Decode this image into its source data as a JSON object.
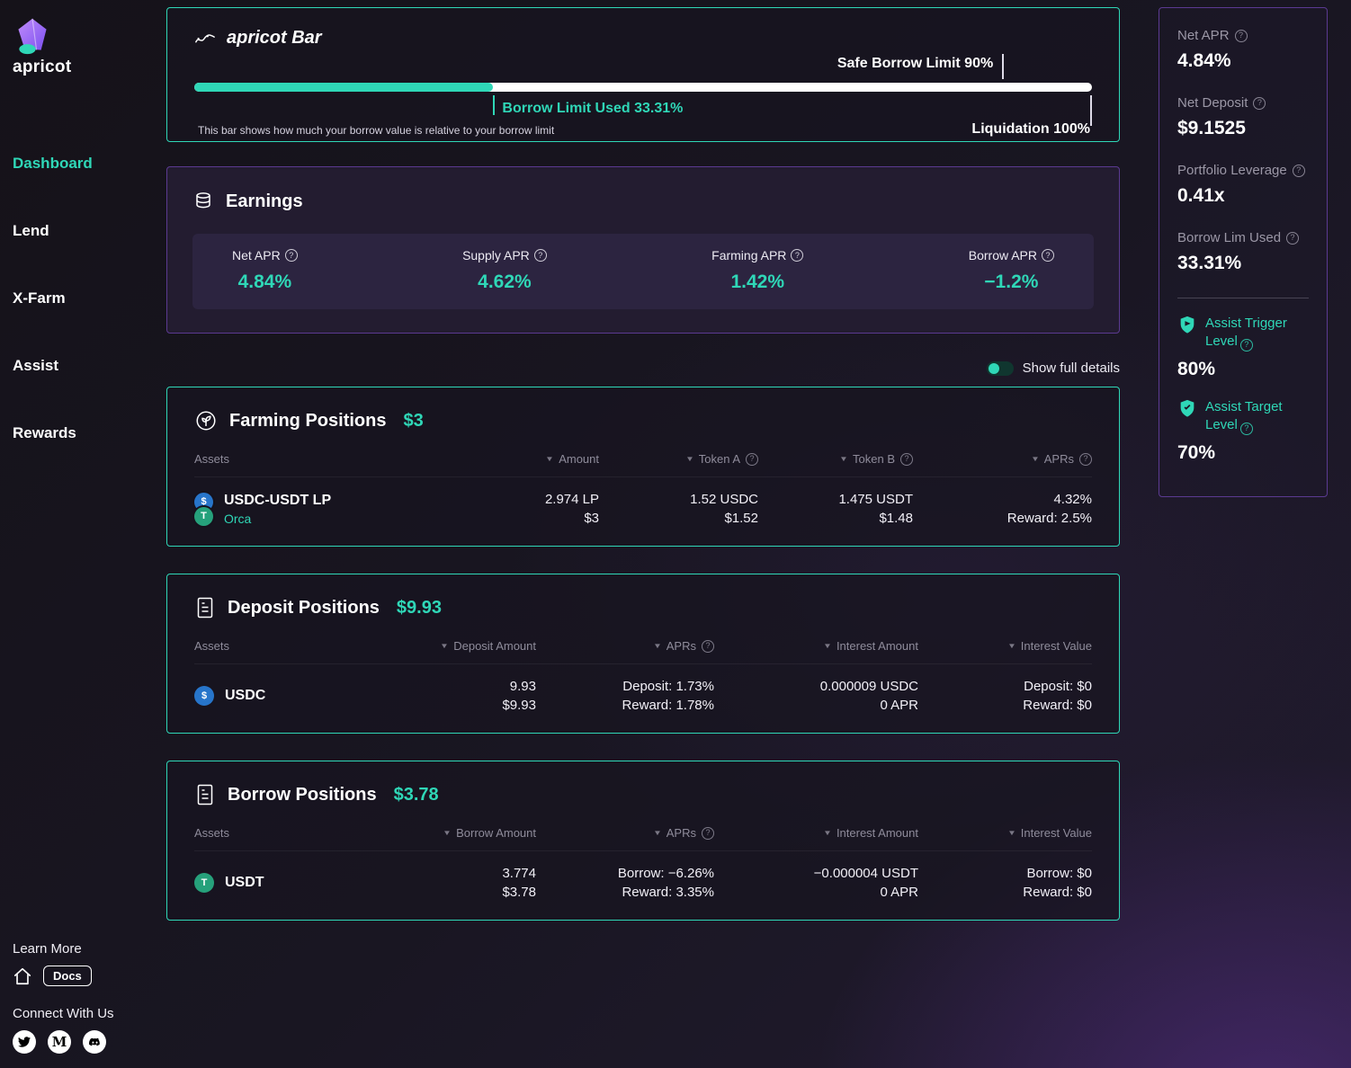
{
  "colors": {
    "teal": "#2fd7b7",
    "purple_border": "#5b3a91"
  },
  "icons": {
    "sort": "▼",
    "help": "?",
    "usdc": "$",
    "usdt": "T",
    "medium": "M"
  },
  "sidebar": {
    "brand": "apricot",
    "items": [
      {
        "label": "Dashboard"
      },
      {
        "label": "Lend"
      },
      {
        "label": "X-Farm"
      },
      {
        "label": "Assist"
      },
      {
        "label": "Rewards"
      }
    ],
    "learn_more": "Learn More",
    "docs_label": "Docs",
    "connect": "Connect With Us"
  },
  "bar_card": {
    "title": "apricot Bar",
    "safe_label": "Safe Borrow Limit 90%",
    "safe_pos": "90%",
    "used_label": "Borrow Limit Used 33.31%",
    "used_pos": "33.31%",
    "fill_pct": "33.31%",
    "liquidation_label": "Liquidation 100%",
    "liquidation_pos": "100%",
    "caption": "This bar shows how much your borrow value is relative to your borrow limit"
  },
  "earnings": {
    "title": "Earnings",
    "metrics": [
      {
        "label": "Net APR",
        "value": "4.84%"
      },
      {
        "label": "Supply APR",
        "value": "4.62%"
      },
      {
        "label": "Farming APR",
        "value": "1.42%"
      },
      {
        "label": "Borrow APR",
        "value": "−1.2%"
      }
    ]
  },
  "toggle": {
    "label": "Show full details"
  },
  "farming": {
    "title": "Farming Positions",
    "total": "$3",
    "headers": [
      "Assets",
      "Amount",
      "Token A",
      "Token B",
      "APRs"
    ],
    "rows": [
      {
        "asset": "USDC-USDT LP",
        "platform": "Orca",
        "amount_1": "2.974 LP",
        "amount_2": "$3",
        "token_a_1": "1.52 USDC",
        "token_a_2": "$1.52",
        "token_b_1": "1.475 USDT",
        "token_b_2": "$1.48",
        "apr_1": "4.32%",
        "apr_2": "Reward: 2.5%"
      }
    ]
  },
  "deposit": {
    "title": "Deposit Positions",
    "total": "$9.93",
    "headers": [
      "Assets",
      "Deposit Amount",
      "APRs",
      "Interest Amount",
      "Interest Value"
    ],
    "rows": [
      {
        "asset": "USDC",
        "amount_1": "9.93",
        "amount_2": "$9.93",
        "apr_1": "Deposit: 1.73%",
        "apr_2": "Reward: 1.78%",
        "interest_1": "0.000009 USDC",
        "interest_2": "0 APR",
        "value_1": "Deposit: $0",
        "value_2": "Reward: $0"
      }
    ]
  },
  "borrow": {
    "title": "Borrow Positions",
    "total": "$3.78",
    "headers": [
      "Assets",
      "Borrow Amount",
      "APRs",
      "Interest Amount",
      "Interest Value"
    ],
    "rows": [
      {
        "asset": "USDT",
        "amount_1": "3.774",
        "amount_2": "$3.78",
        "apr_1": "Borrow: −6.26%",
        "apr_2": "Reward: 3.35%",
        "interest_1": "−0.000004 USDT",
        "interest_2": "0 APR",
        "value_1": "Borrow: $0",
        "value_2": "Reward: $0"
      }
    ]
  },
  "stats_panel": {
    "items": [
      {
        "label": "Net APR",
        "value": "4.84%"
      },
      {
        "label": "Net Deposit",
        "value": "$9.1525"
      },
      {
        "label": "Portfolio Leverage",
        "value": "0.41x"
      },
      {
        "label": "Borrow Lim Used",
        "value": "33.31%"
      }
    ],
    "assist": [
      {
        "label": "Assist Trigger Level",
        "value": "80%"
      },
      {
        "label": "Assist Target Level",
        "value": "70%"
      }
    ]
  }
}
